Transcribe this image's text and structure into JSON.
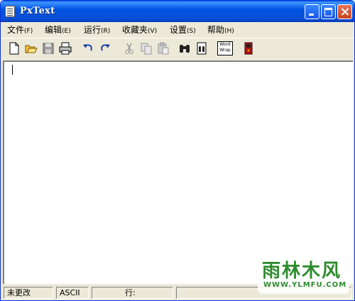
{
  "window": {
    "title": "PxText"
  },
  "menu": [
    {
      "label": "文件",
      "accel": "(F)"
    },
    {
      "label": "编辑",
      "accel": "(E)"
    },
    {
      "label": "运行",
      "accel": "(R)"
    },
    {
      "label": "收藏夹",
      "accel": "(V)"
    },
    {
      "label": "设置",
      "accel": "(S)"
    },
    {
      "label": "帮助",
      "accel": "(H)"
    }
  ],
  "toolbar": {
    "icons": [
      "new-file-icon",
      "open-folder-icon",
      "save-icon",
      "print-icon",
      "undo-icon",
      "redo-icon",
      "cut-icon",
      "copy-icon",
      "paste-icon",
      "find-icon",
      "find-replace-icon",
      "word-wrap-icon",
      "exit-icon"
    ],
    "word_wrap_label_top": "Word",
    "word_wrap_label_bottom": "Wrap"
  },
  "editor": {
    "content": ""
  },
  "status": {
    "modified": "未更改",
    "encoding": "ASCII",
    "line": "行:",
    "extra": ""
  },
  "watermark": {
    "logo": "雨林木风",
    "url": "WWW.YLMFU.COM"
  }
}
